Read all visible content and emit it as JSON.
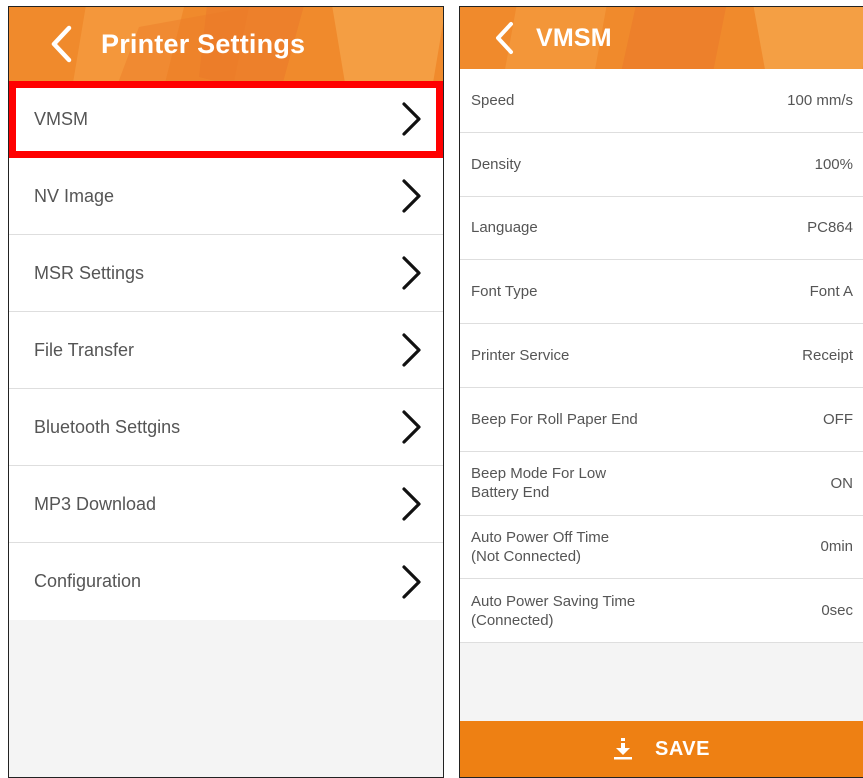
{
  "left_screen": {
    "header": {
      "title": "Printer Settings",
      "back_icon": "chevron-left-icon"
    },
    "menu_items": [
      {
        "label": "VMSM",
        "highlighted": true
      },
      {
        "label": "NV Image"
      },
      {
        "label": "MSR Settings"
      },
      {
        "label": "File Transfer"
      },
      {
        "label": "Bluetooth Settgins"
      },
      {
        "label": "MP3 Download"
      },
      {
        "label": "Configuration"
      }
    ]
  },
  "right_screen": {
    "header": {
      "title": "VMSM",
      "back_icon": "chevron-left-icon"
    },
    "settings": [
      {
        "label": "Speed",
        "value": "100 mm/s"
      },
      {
        "label": "Density",
        "value": "100%"
      },
      {
        "label": "Language",
        "value": "PC864"
      },
      {
        "label": "Font Type",
        "value": "Font A"
      },
      {
        "label": "Printer Service",
        "value": "Receipt"
      },
      {
        "label": "Beep For Roll Paper End",
        "value": "OFF"
      },
      {
        "label": "Beep Mode For Low\nBattery End",
        "value": "ON"
      },
      {
        "label": "Auto Power Off Time\n(Not Connected)",
        "value": "0min"
      },
      {
        "label": "Auto Power Saving Time\n(Connected)",
        "value": "0sec"
      }
    ],
    "save_button": {
      "label": "SAVE",
      "icon": "download-icon"
    }
  },
  "colors": {
    "header_orange": "#f08a2c",
    "save_orange": "#ee8013",
    "highlight_red": "#ff0000"
  }
}
